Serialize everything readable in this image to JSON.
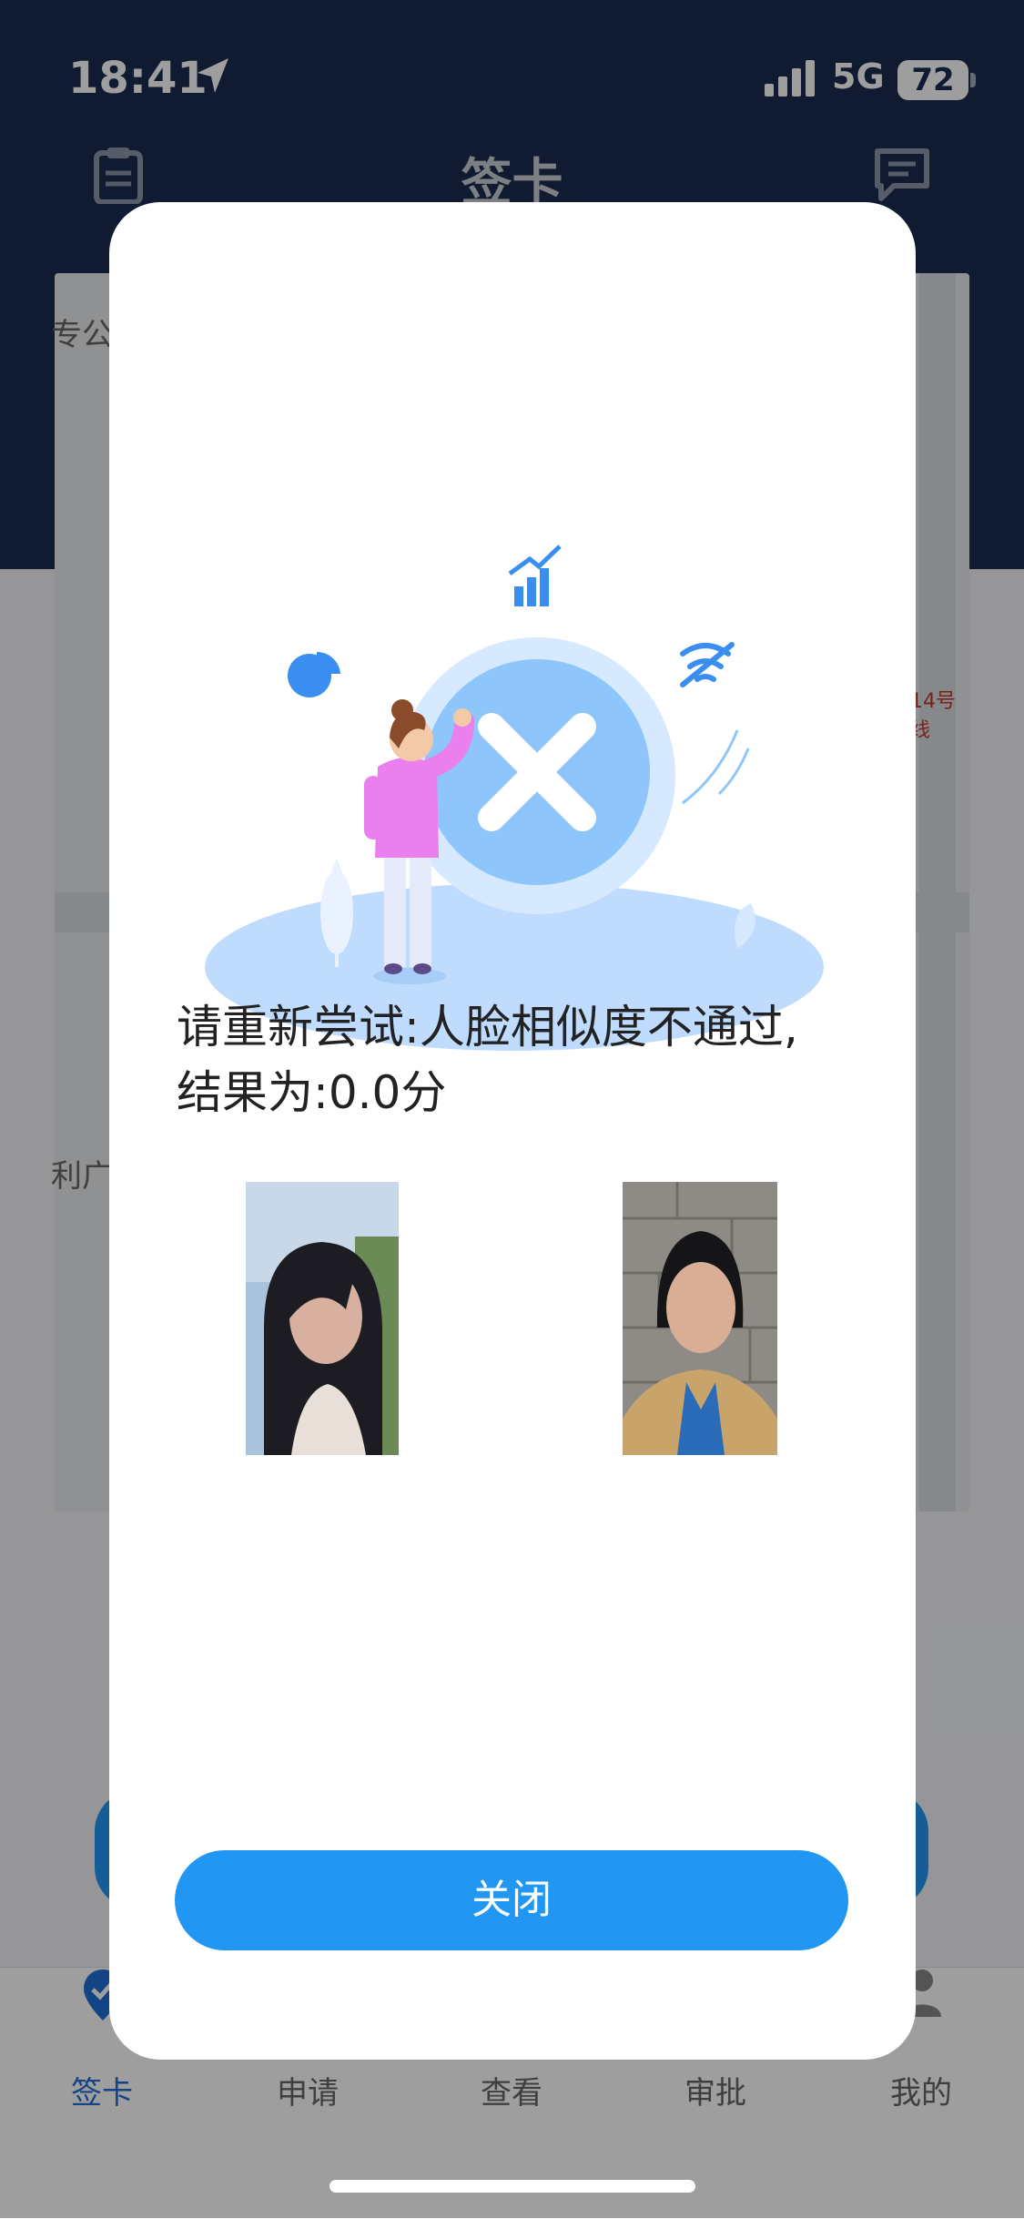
{
  "status_bar": {
    "time": "18:41",
    "network": "5G",
    "battery": "72"
  },
  "nav": {
    "title": "签卡",
    "left_icon": "clipboard-icon",
    "right_icon": "message-icon"
  },
  "map": {
    "labels": [
      "专公",
      "利广",
      "14号线"
    ]
  },
  "tabbar": {
    "tabs": [
      {
        "label": "签卡",
        "icon": "location-check-icon",
        "active": true
      },
      {
        "label": "申请",
        "icon": "apply-icon",
        "active": false
      },
      {
        "label": "查看",
        "icon": "view-icon",
        "active": false
      },
      {
        "label": "审批",
        "icon": "approve-icon",
        "active": false
      },
      {
        "label": "我的",
        "icon": "user-icon",
        "active": false
      }
    ]
  },
  "dialog": {
    "message_line1": "请重新尝试:人脸相似度不通过,",
    "message_line2": "结果为:0.0分",
    "close_label": "关闭",
    "illustration_icon": "error-x-icon"
  },
  "colors": {
    "header": "#1a2d4f",
    "accent": "#2196f3",
    "illustration": "#8ec5fb"
  }
}
